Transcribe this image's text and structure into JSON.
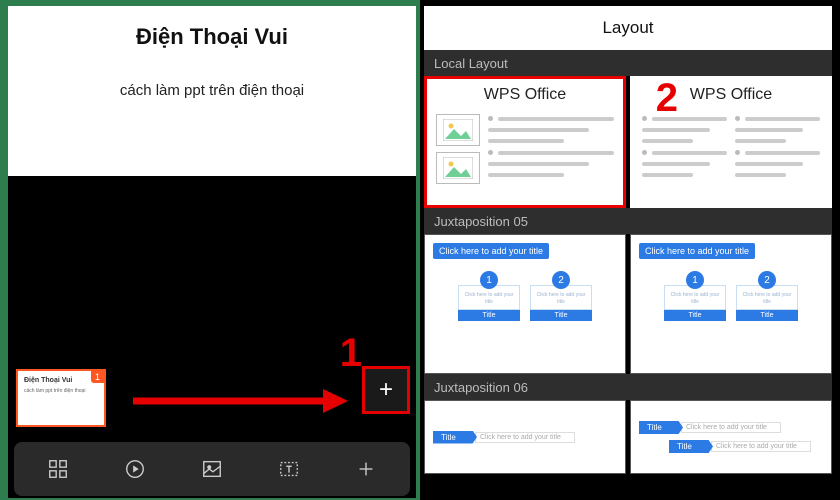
{
  "left": {
    "slide": {
      "title": "Điện Thoại Vui",
      "subtitle": "cách làm ppt trên điện thoại"
    },
    "thumb": {
      "badge": "1",
      "line1": "Điện Thoại Vui",
      "line2": "cách làm ppt trên điện thoại"
    },
    "callout": "1",
    "add_label": "+"
  },
  "right": {
    "header": "Layout",
    "callout": "2",
    "sections": {
      "local": "Local Layout",
      "juxta5": "Juxtaposition 05",
      "juxta6": "Juxtaposition 06"
    },
    "cards": {
      "local1": {
        "title": "WPS Office"
      },
      "local2": {
        "title": "WPS Office"
      },
      "click_title": "Click here to add your title",
      "box_text": "Click here to add your title",
      "box_title": "Title",
      "num1": "1",
      "num2": "2",
      "pill": "Title",
      "pill_text": "Click here to add your title"
    }
  }
}
